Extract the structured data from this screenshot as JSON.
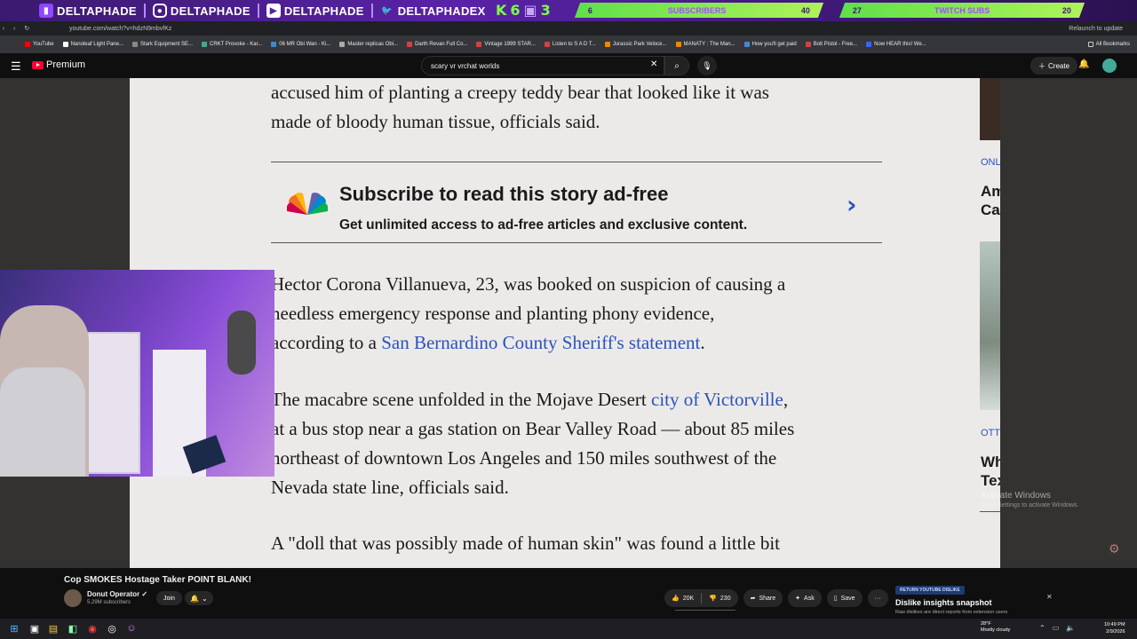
{
  "overlay": {
    "socials": [
      {
        "icon": "twitch-icon",
        "label": "DELTAPHADE"
      },
      {
        "icon": "instagram-icon",
        "label": "DELTAPHADE"
      },
      {
        "icon": "youtube-icon",
        "label": "DELTAPHADE"
      },
      {
        "icon": "twitter-icon",
        "label": "DELTAPHADEX"
      }
    ],
    "counter": {
      "k": "K",
      "six": "6",
      "three": "3"
    },
    "subscribers": {
      "left": "6",
      "label": "SUBSCRIBERS",
      "right": "40"
    },
    "twitch_subs": {
      "left": "27",
      "label": "TWITCH SUBS",
      "right": "20"
    }
  },
  "browser": {
    "url": "youtube.com/watch?v=hdzN9mbvfKz",
    "update_text": "Relaunch to update",
    "bookmarks": [
      "YouTube",
      "Nanoleaf Light Pane...",
      "Stark Equipment SE...",
      "CRKT Provoke - Kar...",
      "06 MR Obi Wan - Ki...",
      "Master replicas Obi...",
      "Darth Revan Full Co...",
      "Vintage 1999 STAR...",
      "Listen to S A D T...",
      "Jurassic Park Veloce...",
      "MANATY : The Man...",
      "How you'll get paid",
      "Bolt Pistol - Free...",
      "Now HEAR this! We..."
    ],
    "all_bookmarks": "All Bookmarks"
  },
  "youtube": {
    "logo_text": "Premium",
    "search_value": "scary vr vrchat worlds",
    "create_label": "Create",
    "video_title": "Cop SMOKES Hostage Taker POINT BLANK!",
    "channel_name": "Donut Operator",
    "channel_subs": "5.29M subscribers",
    "join_label": "Join",
    "likes": "20K",
    "dislikes": "230",
    "share_label": "Share",
    "ask_label": "Ask",
    "save_label": "Save",
    "more_label": "···"
  },
  "article": {
    "para0_line1": "accused him of planting a creepy teddy bear that looked like it was",
    "para0_line2": "made of bloody human tissue, officials said.",
    "subscribe_title": "Subscribe to read this story ad-free",
    "subscribe_desc": "Get unlimited access to ad-free articles and exclusive content.",
    "para1_line1": "Hector Corona Villanueva, 23, was booked on suspicion of causing a",
    "para1_line2": "needless emergency response and planting phony evidence,",
    "para1_line3_pre": "according to a ",
    "para1_link": "San Bernardino County Sheriff's statement",
    "para1_line3_post": ".",
    "para2_line1_pre": "The macabre scene unfolded in the Mojave Desert ",
    "para2_link": "city of Victorville",
    "para2_line1_post": ",",
    "para2_line2": "at a bus stop near a gas station on Bear Valley Road — about 85 miles",
    "para2_line3": "northeast of downtown Los Angeles and 150 miles southwest of the",
    "para2_line4": "Nevada state line, officials said.",
    "para3_line1": "A \"doll that was possibly made of human skin\" was found a little bit"
  },
  "sidebar": {
    "tag1": "ONL",
    "head1_line1": "Am",
    "head1_line2": "Ca",
    "tag2": "OTT",
    "head2_line1": "Wh",
    "head2_line2": "Tex"
  },
  "activation": {
    "title": "Activate Windows",
    "desc": "Go to Settings to activate Windows."
  },
  "ryd": {
    "badge": "RETURN YOUTUBE DISLIKE",
    "title": "Dislike insights snapshot",
    "desc": "Raw dislikes are direct reports from extension users"
  },
  "taskbar": {
    "weather_temp": "28°F",
    "weather_desc": "Mostly cloudy",
    "time": "10:49 PM",
    "date": "2/9/2026"
  },
  "colors": {
    "overlay_bg": "#5a22a8",
    "overlay_accent": "#7cff4a",
    "yt_red": "#ff0033",
    "link_blue": "#2a52be"
  }
}
